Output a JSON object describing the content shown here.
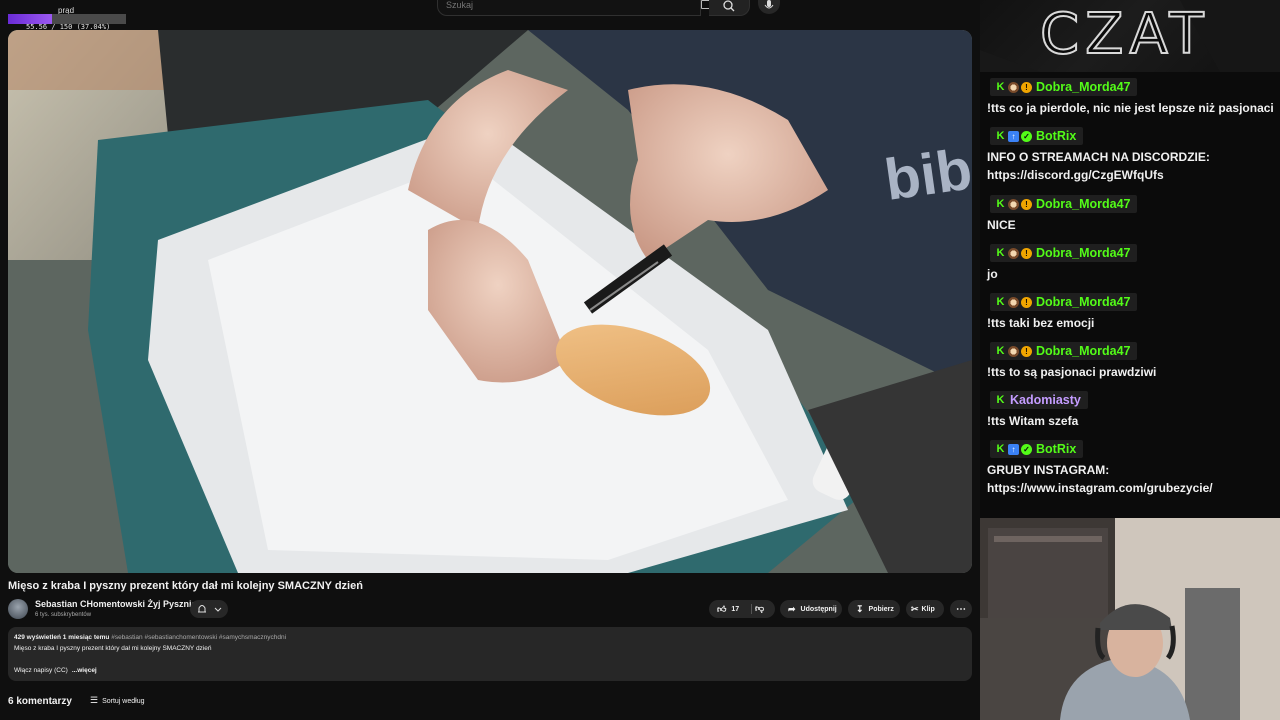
{
  "power": {
    "label": "prąd",
    "value_text": "55.56 / 150 (37.04%)",
    "fraction": 0.3704,
    "color": "#8a45e8"
  },
  "search": {
    "placeholder": "Szukaj"
  },
  "video": {
    "title": "Mięso z kraba I pyszny prezent który dał mi kolejny SMACZNY dzień",
    "channel": "Sebastian CHomentowski Żyj Pysznie",
    "subscribers": "6 tys. subskrybentów",
    "likes": "17",
    "share_label": "Udostępnij",
    "download_label": "Pobierz",
    "clip_label": "Klip",
    "meta": "429 wyświetleń  1 miesiąc temu",
    "tags": "#sebastian #sebastianchomentowski #samychsmacznychdni",
    "description": "Mięso z kraba I pyszny prezent który dał mi kolejny SMACZNY dzień",
    "captions": "Włącz napisy (CC)",
    "more": "...więcej",
    "comments": "6 komentarzy",
    "sort": "Sortuj według"
  },
  "chat": {
    "header": "CZAT",
    "messages": [
      {
        "user": "Dobra_Morda47",
        "color": "#53fc18",
        "badges": [
          "kick",
          "og",
          "coin"
        ],
        "lines": [
          "!tts co ja pierdole, nic nie jest lepsze niż pasjonaci"
        ]
      },
      {
        "user": "BotRix",
        "color": "#53fc18",
        "badges": [
          "kick",
          "bot",
          "verified"
        ],
        "lines": [
          "INFO O STREAMACH NA DISCORDZIE:",
          "https://discord.gg/CzgEWfqUfs"
        ]
      },
      {
        "user": "Dobra_Morda47",
        "color": "#53fc18",
        "badges": [
          "kick",
          "og",
          "coin"
        ],
        "lines": [
          "NICE"
        ]
      },
      {
        "user": "Dobra_Morda47",
        "color": "#53fc18",
        "badges": [
          "kick",
          "og",
          "coin"
        ],
        "lines": [
          "jo"
        ]
      },
      {
        "user": "Dobra_Morda47",
        "color": "#53fc18",
        "badges": [
          "kick",
          "og",
          "coin"
        ],
        "lines": [
          "!tts taki bez emocji"
        ]
      },
      {
        "user": "Dobra_Morda47",
        "color": "#53fc18",
        "badges": [
          "kick",
          "og",
          "coin"
        ],
        "lines": [
          "!tts to są pasjonaci prawdziwi"
        ]
      },
      {
        "user": "Kadomiasty",
        "color": "#c49cff",
        "badges": [
          "kick"
        ],
        "lines": [
          "!tts Witam szefa"
        ]
      },
      {
        "user": "BotRix",
        "color": "#53fc18",
        "badges": [
          "kick",
          "bot",
          "verified"
        ],
        "lines": [
          "GRUBY INSTAGRAM:",
          "https://www.instagram.com/grubezycie/"
        ]
      }
    ]
  }
}
